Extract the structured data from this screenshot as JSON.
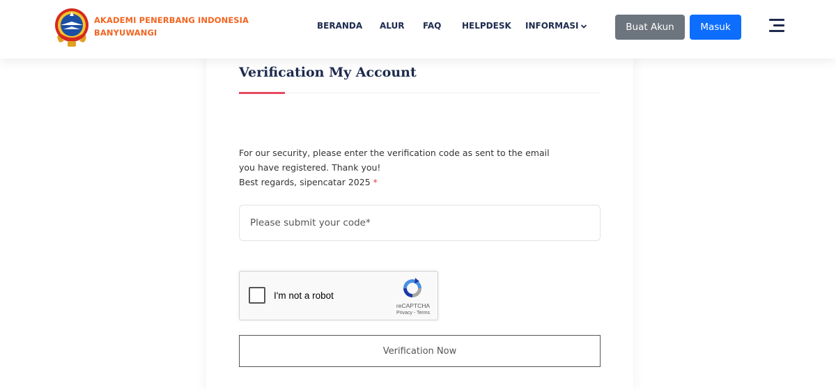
{
  "header": {
    "brand_line1": "AKADEMI PENERBANG INDONESIA",
    "brand_line2": "BANYUWANGI",
    "logo_icon": "academy-emblem-icon",
    "nav": [
      {
        "label": "BERANDA"
      },
      {
        "label": "ALUR"
      },
      {
        "label": "FAQ"
      },
      {
        "label": "HELPDESK"
      },
      {
        "label": "INFORMASI",
        "icon": "chevron-down-icon"
      }
    ],
    "register_button": "Buat Akun",
    "login_button": "Masuk",
    "menu_icon": "hamburger-menu-icon"
  },
  "form": {
    "title": "Verification My Account",
    "description_line1": "For our security, please enter the verification code as sent to the email",
    "description_line2": "you have registered. Thank you!",
    "description_line3": "Best regards, sipencatar 2025",
    "required_mark": "*",
    "code_placeholder": "Please submit your code*",
    "code_value": "",
    "submit_button": "Verification Now"
  },
  "recaptcha": {
    "label": "I'm not a robot",
    "brand": "reCAPTCHA",
    "links": "Privacy - Terms",
    "checked": false
  },
  "colors": {
    "brand_orange": "#f26522",
    "navy": "#1d2a4d",
    "accent_red": "#e84a5f",
    "btn_gray": "#6c757d",
    "btn_blue": "#0d6efd"
  }
}
